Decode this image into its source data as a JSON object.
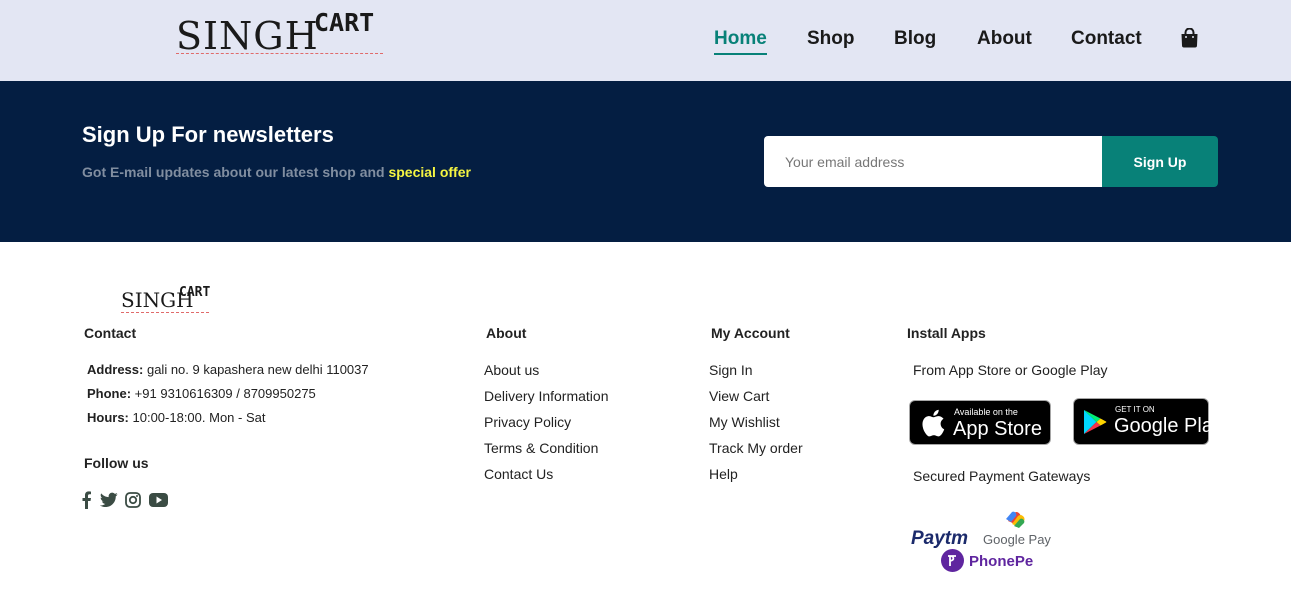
{
  "header": {
    "logo_main": "SINGH",
    "logo_sup": "CART",
    "nav": [
      {
        "label": "Home",
        "active": true
      },
      {
        "label": "Shop",
        "active": false
      },
      {
        "label": "Blog",
        "active": false
      },
      {
        "label": "About",
        "active": false
      },
      {
        "label": "Contact",
        "active": false
      }
    ],
    "cart_icon": "shopping-bag-icon"
  },
  "newsletter": {
    "title": "Sign Up For newsletters",
    "subtitle_prefix": "Got E-mail updates about our latest shop and ",
    "subtitle_highlight": "special offer",
    "email_placeholder": "Your email address",
    "button_label": "Sign Up"
  },
  "footer": {
    "logo_main": "SINGH",
    "logo_sup": "CART",
    "contact": {
      "heading": "Contact",
      "address_label": "Address:",
      "address_value": " gali no. 9 kapashera new delhi 110037",
      "phone_label": "Phone:",
      "phone_value": " +91 9310616309 / 8709950275",
      "hours_label": "Hours:",
      "hours_value": " 10:00-18:00. Mon - Sat"
    },
    "follow": {
      "heading": "Follow us",
      "icons": [
        "facebook-icon",
        "twitter-icon",
        "instagram-icon",
        "youtube-icon"
      ]
    },
    "about": {
      "heading": "About",
      "links": [
        "About us",
        "Delivery Information",
        "Privacy Policy",
        "Terms & Condition",
        "Contact Us"
      ]
    },
    "account": {
      "heading": "My Account",
      "links": [
        "Sign In",
        "View Cart",
        "My Wishlist",
        "Track My order",
        "Help"
      ]
    },
    "apps": {
      "heading": "Install Apps",
      "subtitle": "From App Store or Google Play",
      "app_store_small": "Available on the",
      "app_store_big": "App Store",
      "google_play_small": "GET IT ON",
      "google_play_big": "Google Play",
      "payments_heading": "Secured Payment Gateways",
      "paytm": "Paytm",
      "gpay": "Google Pay",
      "phonepe": "PhonePe"
    }
  },
  "colors": {
    "header_bg": "#e3e6f3",
    "newsletter_bg": "#041e42",
    "accent": "#088178",
    "highlight": "#f5f542"
  }
}
